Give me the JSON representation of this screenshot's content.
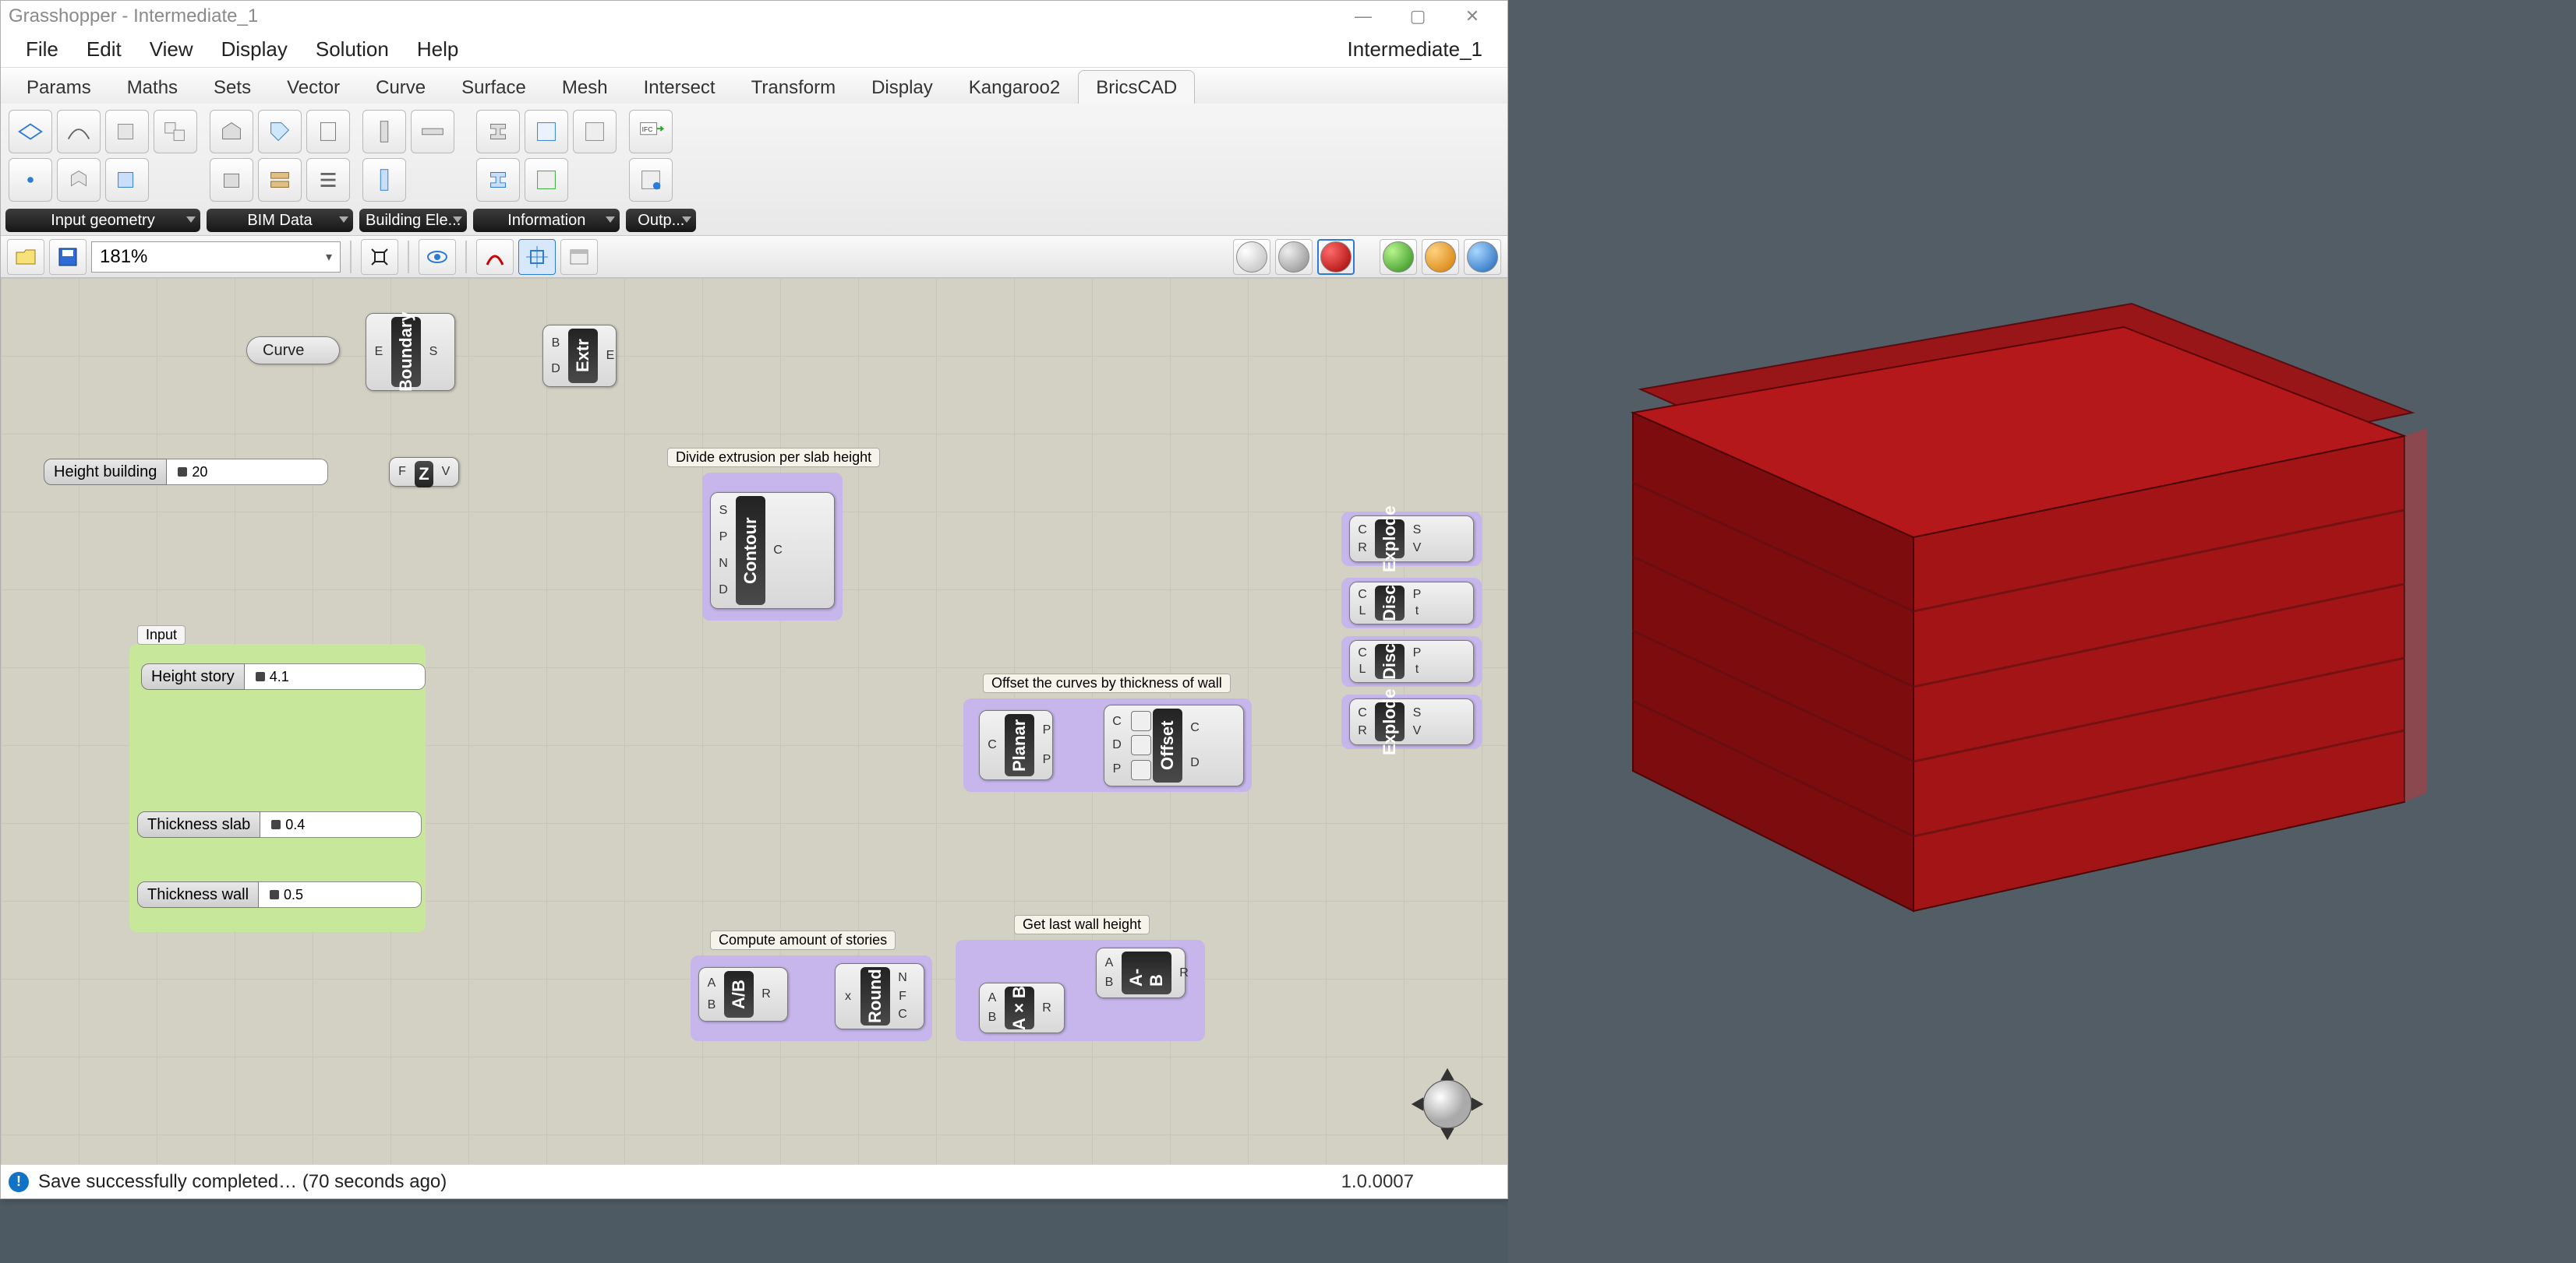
{
  "window": {
    "title": "Grasshopper - Intermediate_1"
  },
  "menubar": {
    "items": [
      "File",
      "Edit",
      "View",
      "Display",
      "Solution",
      "Help"
    ],
    "doc": "Intermediate_1"
  },
  "tabs": {
    "items": [
      "Params",
      "Maths",
      "Sets",
      "Vector",
      "Curve",
      "Surface",
      "Mesh",
      "Intersect",
      "Transform",
      "Display",
      "Kangaroo2",
      "BricsCAD"
    ],
    "active": 11
  },
  "ribbon_panels": [
    "Input geometry",
    "BIM Data",
    "Building Ele...",
    "Information",
    "Outp..."
  ],
  "quickbar": {
    "zoom": "181%"
  },
  "canvas": {
    "curve_param": "Curve",
    "sliders": {
      "height_building": {
        "label": "Height building",
        "value": "20"
      },
      "height_story": {
        "label": "Height story",
        "value": "4.1"
      },
      "thickness_slab": {
        "label": "Thickness slab",
        "value": "0.4"
      },
      "thickness_wall": {
        "label": "Thickness wall",
        "value": "0.5"
      }
    },
    "groups": {
      "input": "Input",
      "divide": "Divide extrusion per slab height",
      "offset": "Offset the curves by thickness of wall",
      "stories": "Compute amount of stories",
      "lastwall": "Get last wall height"
    },
    "nodes": {
      "boundary": "Boundary",
      "extr": "Extr",
      "neg": "Z",
      "contour": "Contour",
      "planar": "Planar",
      "offset": "Offset",
      "round": "Round",
      "div": "A/B",
      "mul": "A×B",
      "sub": "A-B",
      "explode": "Explode",
      "disc": "Disc"
    }
  },
  "status": {
    "msg": "Save successfully completed… (70 seconds ago)",
    "version": "1.0.0007"
  }
}
